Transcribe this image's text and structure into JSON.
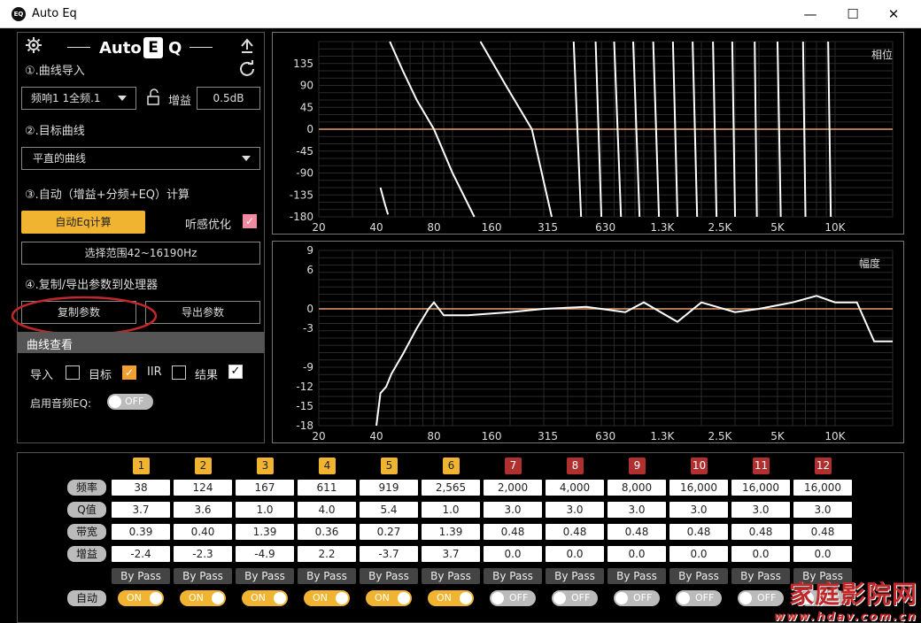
{
  "window": {
    "title": "Auto Eq",
    "minimize": "—",
    "maximize": "☐",
    "close": "✕"
  },
  "logo": {
    "text_left": "Auto",
    "letter": "E",
    "text_right": "Q"
  },
  "left": {
    "step1": "①.曲线导入",
    "source_select": "频响1  1全频.1",
    "gain_label": "增益",
    "gain_value": "0.5dB",
    "step2": "②.目标曲线",
    "target_select": "平直的曲线",
    "step3": "③.自动（增益+分频+EQ）计算",
    "auto_eq_button": "自动Eq计算",
    "listen_opt_label": "听感优化",
    "range_button": "选择范围42~16190Hz",
    "step4": "④.复制/导出参数到处理器",
    "copy_button": "复制参数",
    "export_button": "导出参数",
    "curve_view_header": "曲线查看",
    "cb_import": "导入",
    "cb_target": "目标",
    "cb_iir": "IIR",
    "cb_result": "结果",
    "audio_eq_label": "启用音频EQ:",
    "audio_eq_toggle": "OFF"
  },
  "phase_chart": {
    "label": "相位",
    "yticks": [
      "135",
      "90",
      "45",
      "0",
      "-45",
      "-90",
      "-135",
      "-180"
    ],
    "xticks": [
      "20",
      "40",
      "80",
      "160",
      "315",
      "630",
      "1.3K",
      "2.5K",
      "5K",
      "10K"
    ]
  },
  "mag_chart": {
    "label": "幅度",
    "yticks": [
      "9",
      "6",
      "0",
      "-3",
      "-9",
      "-12",
      "-15",
      "-18"
    ],
    "xticks": [
      "20",
      "40",
      "80",
      "160",
      "315",
      "630",
      "1.3K",
      "2.5K",
      "5K",
      "10K"
    ]
  },
  "chart_data": [
    {
      "type": "line",
      "title": "相位",
      "xscale": "log",
      "ylim": [
        -180,
        180
      ],
      "series": [
        {
          "x": [
            42,
            44,
            46
          ],
          "y": [
            -120,
            -150,
            -175
          ]
        },
        {
          "x": [
            47,
            55,
            65,
            80,
            100,
            130
          ],
          "y": [
            180,
            120,
            60,
            0,
            -90,
            -180
          ]
        },
        {
          "x": [
            140,
            190,
            260,
            330
          ],
          "y": [
            180,
            90,
            0,
            -180
          ]
        }
      ]
    },
    {
      "type": "line",
      "title": "幅度",
      "xscale": "log",
      "ylim": [
        -18,
        9
      ],
      "series": [
        {
          "x": [
            40,
            42,
            45,
            48,
            55,
            65,
            75,
            80,
            90,
            120,
            200,
            300,
            500,
            800,
            1000,
            1500,
            2000,
            3000,
            4000,
            6000,
            8000,
            10000,
            13000,
            16000,
            20000
          ],
          "y": [
            -18,
            -13,
            -12,
            -10,
            -7,
            -3,
            0,
            1,
            -1,
            -1,
            -0.5,
            0,
            0.3,
            -0.5,
            1,
            -2,
            1,
            -0.5,
            0,
            1,
            2,
            1,
            1,
            -5,
            -5
          ]
        }
      ]
    }
  ],
  "bands": [
    {
      "num": "1",
      "type": "y",
      "freq": "38",
      "q": "3.7",
      "bw": "0.39",
      "gain": "-2.4",
      "bypass": "By Pass",
      "auto": "ON"
    },
    {
      "num": "2",
      "type": "y",
      "freq": "124",
      "q": "3.6",
      "bw": "0.40",
      "gain": "-2.3",
      "bypass": "By Pass",
      "auto": "ON"
    },
    {
      "num": "3",
      "type": "y",
      "freq": "167",
      "q": "1.0",
      "bw": "1.39",
      "gain": "-4.9",
      "bypass": "By Pass",
      "auto": "ON"
    },
    {
      "num": "4",
      "type": "y",
      "freq": "611",
      "q": "4.0",
      "bw": "0.36",
      "gain": "2.2",
      "bypass": "By Pass",
      "auto": "ON"
    },
    {
      "num": "5",
      "type": "y",
      "freq": "919",
      "q": "5.4",
      "bw": "0.27",
      "gain": "-3.7",
      "bypass": "By Pass",
      "auto": "ON"
    },
    {
      "num": "6",
      "type": "y",
      "freq": "2,565",
      "q": "1.0",
      "bw": "1.39",
      "gain": "3.7",
      "bypass": "By Pass",
      "auto": "ON"
    },
    {
      "num": "7",
      "type": "r",
      "freq": "2,000",
      "q": "3.0",
      "bw": "0.48",
      "gain": "0.0",
      "bypass": "By Pass",
      "auto": "OFF"
    },
    {
      "num": "8",
      "type": "r",
      "freq": "4,000",
      "q": "3.0",
      "bw": "0.48",
      "gain": "0.0",
      "bypass": "By Pass",
      "auto": "OFF"
    },
    {
      "num": "9",
      "type": "r",
      "freq": "8,000",
      "q": "3.0",
      "bw": "0.48",
      "gain": "0.0",
      "bypass": "By Pass",
      "auto": "OFF"
    },
    {
      "num": "10",
      "type": "r",
      "freq": "16,000",
      "q": "3.0",
      "bw": "0.48",
      "gain": "0.0",
      "bypass": "By Pass",
      "auto": "OFF"
    },
    {
      "num": "11",
      "type": "r",
      "freq": "16,000",
      "q": "3.0",
      "bw": "0.48",
      "gain": "0.0",
      "bypass": "By Pass",
      "auto": "OFF"
    },
    {
      "num": "12",
      "type": "r",
      "freq": "16,000",
      "q": "3.0",
      "bw": "0.48",
      "gain": "0.0",
      "bypass": "By Pass",
      "auto": "OFF"
    }
  ],
  "row_labels": {
    "freq": "频率",
    "q": "Q值",
    "bw": "带宽",
    "gain": "增益",
    "auto": "自动"
  },
  "watermark": {
    "main": "家庭影院网",
    "sub": "www.hdav.com.cn"
  },
  "colors": {
    "accent": "#f0b430",
    "red_band": "#b03030",
    "zero_line": "#e8a070",
    "annotation_circle": "#c0282a"
  }
}
